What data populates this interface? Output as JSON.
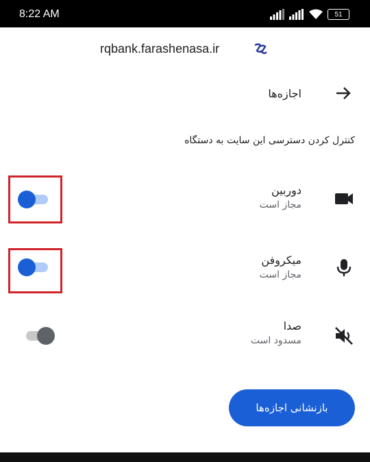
{
  "status_bar": {
    "time": "8:22 AM",
    "battery": "51"
  },
  "site": {
    "domain": "rqbank.farashenasa.ir"
  },
  "header": {
    "title": "اجازه‌ها"
  },
  "description": "کنترل کردن دسترسی این سایت به دستگاه",
  "permissions": [
    {
      "name": "دوربین",
      "status": "مجاز است",
      "icon": "videocam-icon",
      "enabled": true
    },
    {
      "name": "میکروفن",
      "status": "مجاز است",
      "icon": "mic-icon",
      "enabled": true
    },
    {
      "name": "صدا",
      "status": "مسدود است",
      "icon": "volume-off-icon",
      "enabled": false
    }
  ],
  "actions": {
    "reset_label": "بازنشانی اجازه‌ها"
  },
  "colors": {
    "accent": "#1a5fd6",
    "highlight": "#d1232a"
  }
}
